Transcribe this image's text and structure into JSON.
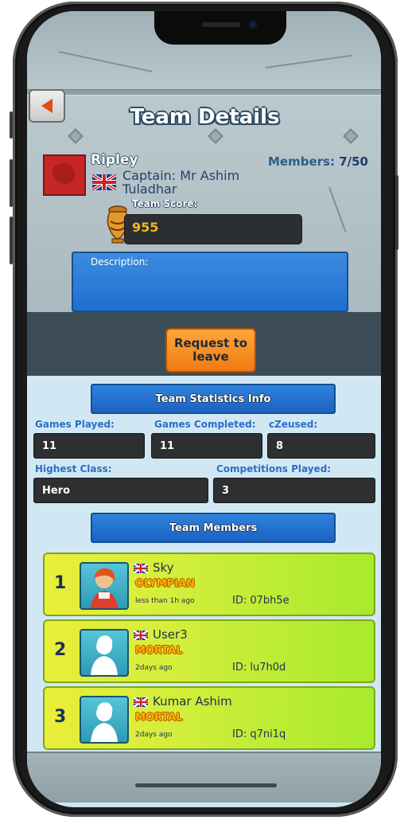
{
  "header": {
    "title": "Team Details"
  },
  "team": {
    "name": "Ripley",
    "captain_label": "Captain: Mr Ashim Tuladhar",
    "members_label": "Members:",
    "members_value": "7/50",
    "score_label": "Team Score:",
    "score_value": "955",
    "description_label": "Description:"
  },
  "actions": {
    "request_leave": "Request to leave"
  },
  "stats": {
    "section_title": "Team Statistics Info",
    "games_played_label": "Games Played:",
    "games_played_value": "11",
    "games_completed_label": "Games Completed:",
    "games_completed_value": "11",
    "czeused_label": "cZeused:",
    "czeused_value": "8",
    "highest_class_label": "Highest Class:",
    "highest_class_value": "Hero",
    "competitions_label": "Competitions Played:",
    "competitions_value": "3"
  },
  "members_section": {
    "title": "Team Members",
    "list": [
      {
        "rank": "1",
        "name": "Sky",
        "class": "OLYMPIAN",
        "last_seen": "less than 1h ago",
        "id": "ID: 07bh5e"
      },
      {
        "rank": "2",
        "name": "User3",
        "class": "MORTAL",
        "last_seen": "2days ago",
        "id": "ID: lu7h0d"
      },
      {
        "rank": "3",
        "name": "Kumar Ashim",
        "class": "MORTAL",
        "last_seen": "2days ago",
        "id": "ID: q7ni1q"
      }
    ]
  },
  "colors": {
    "accent_blue": "#2f84dc",
    "button_orange": "#f07a12",
    "score_gold": "#f2b526",
    "card_green": "#a7ea2e"
  }
}
